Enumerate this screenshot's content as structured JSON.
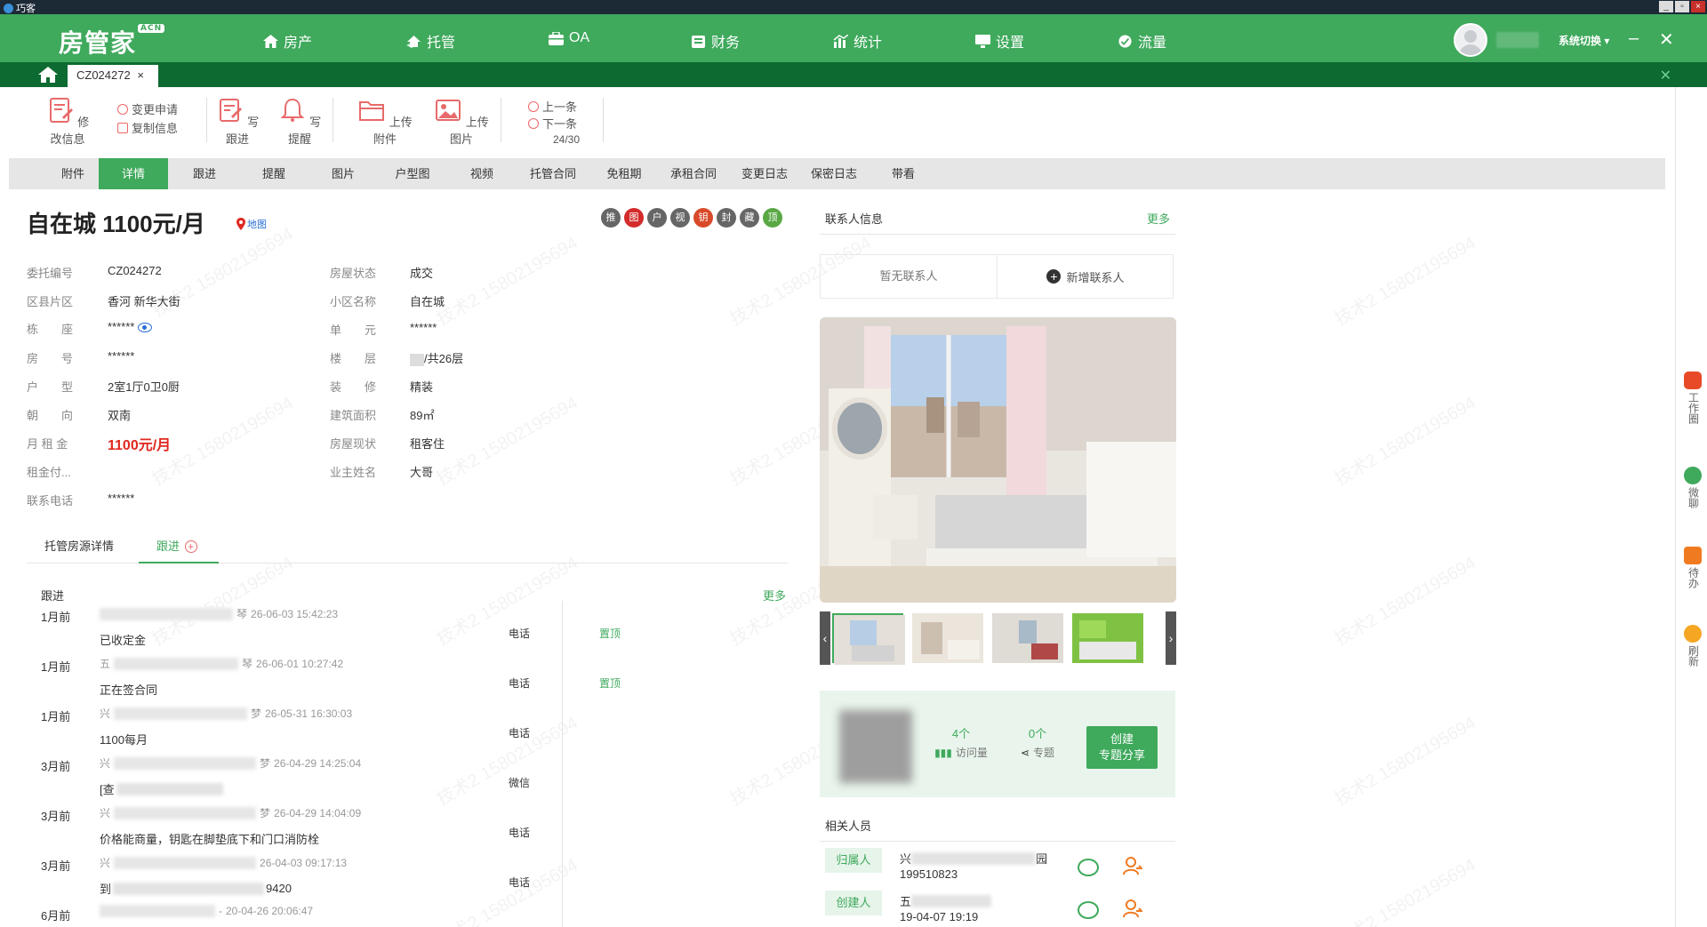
{
  "app": {
    "title": "巧客",
    "brand": "房管家",
    "brand_badge": "ACN"
  },
  "nav": [
    {
      "label": "房产",
      "icon": "house-icon"
    },
    {
      "label": "托管",
      "icon": "hosting-icon"
    },
    {
      "label": "OA",
      "icon": "briefcase-icon"
    },
    {
      "label": "财务",
      "icon": "finance-icon"
    },
    {
      "label": "统计",
      "icon": "chart-icon"
    },
    {
      "label": "设置",
      "icon": "monitor-icon"
    },
    {
      "label": "流量",
      "icon": "traffic-icon"
    }
  ],
  "user": {
    "switch_label": "系统切换"
  },
  "doc_tab": {
    "label": "CZ024272",
    "close": "×"
  },
  "toolbar": {
    "edit": "修改信息",
    "change_request": "变更申请",
    "copy_info": "复制信息",
    "write_followup": "写跟进",
    "write_reminder": "写提醒",
    "upload_attachment": "上传附件",
    "upload_image": "上传图片",
    "prev": "上一条",
    "next": "下一条",
    "position": "24/30"
  },
  "subnav": [
    "附件",
    "详情",
    "跟进",
    "提醒",
    "图片",
    "户型图",
    "视频",
    "托管合同",
    "免租期",
    "承租合同",
    "变更日志",
    "保密日志",
    "带看"
  ],
  "listing": {
    "title": "自在城 1100元/月",
    "map_label": "地图",
    "badges": [
      {
        "label": "推",
        "color": "#666666"
      },
      {
        "label": "图",
        "color": "#d42b2b"
      },
      {
        "label": "户",
        "color": "#666666"
      },
      {
        "label": "视",
        "color": "#666666"
      },
      {
        "label": "钥",
        "color": "#d94a2a"
      },
      {
        "label": "封",
        "color": "#666666"
      },
      {
        "label": "藏",
        "color": "#666666"
      },
      {
        "label": "顶",
        "color": "#5aa845"
      }
    ]
  },
  "fields_left": [
    {
      "label": "委托编号",
      "value": "CZ024272"
    },
    {
      "label": "区县片区",
      "value": "香河 新华大街"
    },
    {
      "label": "栋　　座",
      "value": "******"
    },
    {
      "label": "房　　号",
      "value": "******"
    },
    {
      "label": "户　　型",
      "value": "2室1厅0卫0厨"
    },
    {
      "label": "朝　　向",
      "value": "双南"
    },
    {
      "label": "月 租 金",
      "value": "1100元/月"
    },
    {
      "label": "租金付...",
      "value": ""
    },
    {
      "label": "联系电话",
      "value": "******"
    }
  ],
  "fields_right": [
    {
      "label": "房屋状态",
      "value": "成交"
    },
    {
      "label": "小区名称",
      "value": "自在城"
    },
    {
      "label": "单　　元",
      "value": "******"
    },
    {
      "label": "楼　　层",
      "value": "/共26层"
    },
    {
      "label": "装　　修",
      "value": "精装"
    },
    {
      "label": "建筑面积",
      "value": "89㎡"
    },
    {
      "label": "房屋现状",
      "value": "租客住"
    },
    {
      "label": "业主姓名",
      "value": "大哥"
    }
  ],
  "inner_tabs": {
    "detail": "托管房源详情",
    "followup": "跟进"
  },
  "followups": {
    "header": "跟进",
    "more": "更多",
    "items": [
      {
        "time": "1月前",
        "meta_tail": "琴",
        "date": "26-06-03 15:42:23",
        "text": "已收定金",
        "text_tail": "",
        "type": "电话",
        "pin": "置顶"
      },
      {
        "time": "1月前",
        "meta_head": "五",
        "meta_tail": "琴",
        "date": "26-06-01 10:27:42",
        "text": "正在签合同",
        "text_tail": "",
        "type": "电话",
        "pin": "置顶"
      },
      {
        "time": "1月前",
        "meta_head": "兴",
        "meta_tail": "梦",
        "date": "26-05-31 16:30:03",
        "text": "1100每月",
        "text_tail": "",
        "type": "电话",
        "pin": ""
      },
      {
        "time": "3月前",
        "meta_head": "兴",
        "meta_tail": "梦",
        "date": "26-04-29 14:25:04",
        "text": "[查",
        "text_tail": "",
        "type": "微信",
        "pin": ""
      },
      {
        "time": "3月前",
        "meta_head": "兴",
        "meta_tail": "梦",
        "date": "26-04-29 14:04:09",
        "text": "价格能商量，钥匙在脚垫底下和门口消防栓",
        "text_tail": "",
        "type": "电话",
        "pin": ""
      },
      {
        "time": "3月前",
        "meta_head": "兴",
        "meta_tail": "",
        "date": "26-04-03 09:17:13",
        "text": "到",
        "text_tail": "9420",
        "type": "电话",
        "pin": ""
      },
      {
        "time": "6月前",
        "meta_head": "",
        "meta_tail": "-",
        "date": "20-04-26 20:06:47",
        "text": "",
        "text_tail": "",
        "type": "",
        "pin": ""
      }
    ]
  },
  "contacts": {
    "title": "联系人信息",
    "more": "更多",
    "none": "暂无联系人",
    "add": "新增联系人"
  },
  "stats": {
    "visits_count": "4个",
    "visits_label": "访问量",
    "topics_count": "0个",
    "topics_label": "专题",
    "share_btn_line1": "创建",
    "share_btn_line2": "专题分享"
  },
  "related": {
    "title": "相关人员",
    "people": [
      {
        "role": "归属人",
        "name_head": "兴",
        "name_tail": "园",
        "phone": "199510823"
      },
      {
        "role": "创建人",
        "name_head": "五",
        "name_tail": "",
        "phone": "19-04-07 19:19"
      }
    ]
  },
  "rail": [
    {
      "label": "工作圈",
      "color": "#e84a27",
      "icon": "camera-icon"
    },
    {
      "label": "微聊",
      "color": "#3fa95c",
      "icon": "chat-bubble-icon"
    },
    {
      "label": "待办",
      "color": "#f07a20",
      "icon": "todo-icon"
    },
    {
      "label": "刷新",
      "color": "#f5a623",
      "icon": "refresh-icon"
    }
  ],
  "watermark": "技术2 15802195694"
}
